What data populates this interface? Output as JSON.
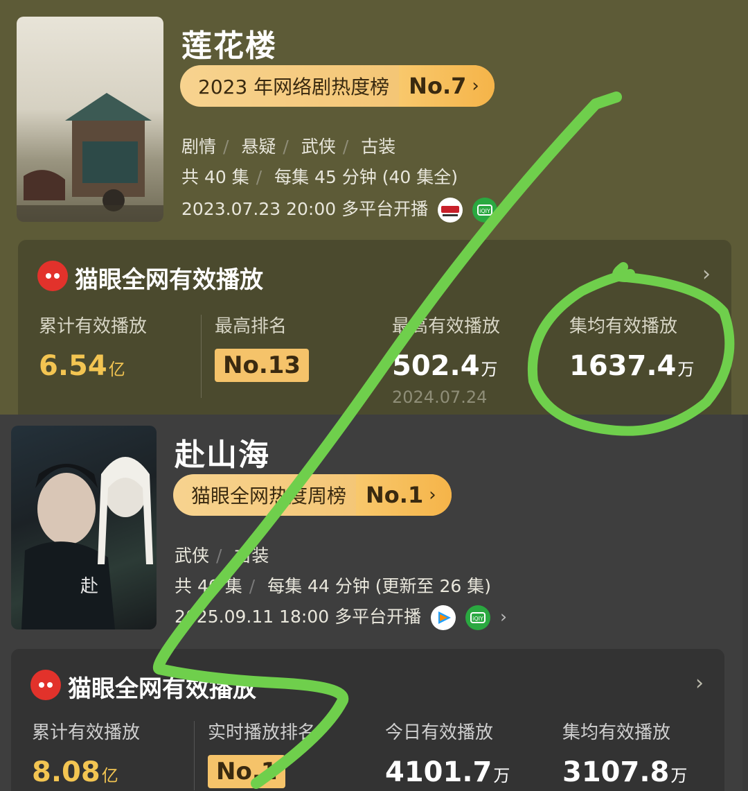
{
  "top": {
    "title": "莲花楼",
    "rank": {
      "label": "2023 年网络剧热度榜",
      "no": "No.7",
      "chevron": "›"
    },
    "genres": [
      "剧情",
      "悬疑",
      "武侠",
      "古装"
    ],
    "episodes": "共 40 集",
    "duration": "每集 45 分钟 (40 集全)",
    "release": "2023.07.23 20:00 多平台开播",
    "platforms": [
      "cctv-icon",
      "iqiyi-icon"
    ],
    "stats": {
      "title": "猫眼全网有效播放",
      "cumulative_label": "累计有效播放",
      "cumulative_value": "6.54",
      "cumulative_unit": "亿",
      "best_rank_label": "最高排名",
      "best_rank_value": "No.13",
      "peak_label": "最高有效播放",
      "peak_value": "502.4",
      "peak_unit": "万",
      "peak_date": "2024.07.24",
      "avg_label": "集均有效播放",
      "avg_value": "1637.4",
      "avg_unit": "万"
    }
  },
  "bottom": {
    "title": "赴山海",
    "rank": {
      "label": "猫眼全网热度周榜",
      "no": "No.1",
      "chevron": "›"
    },
    "genres": [
      "武侠",
      "古装"
    ],
    "episodes": "共 40 集",
    "duration": "每集 44 分钟 (更新至 26 集)",
    "release": "2025.09.11 18:00 多平台开播",
    "platforms": [
      "tencent-video-icon",
      "iqiyi-icon"
    ],
    "release_chevron": "›",
    "stats": {
      "title": "猫眼全网有效播放",
      "cumulative_label": "累计有效播放",
      "cumulative_value": "8.08",
      "cumulative_unit": "亿",
      "realtime_rank_label": "实时播放排名",
      "realtime_rank_value": "No.1",
      "today_label": "今日有效播放",
      "today_value": "4101.7",
      "today_unit": "万",
      "avg_label": "集均有效播放",
      "avg_value": "3107.8",
      "avg_unit": "万"
    }
  },
  "colors": {
    "top_bg": "#5d5b37",
    "bottom_bg": "#3e3e3e",
    "gold": "#f3c552",
    "pill": "#f5c06a",
    "annotation": "#6fcf4c"
  },
  "chevron": "›"
}
